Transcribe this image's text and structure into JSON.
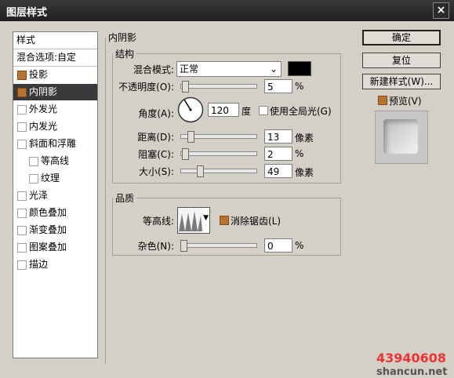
{
  "window": {
    "title": "图层样式",
    "close": "×"
  },
  "styles_list": {
    "header": "样式",
    "blend_options": "混合选项:自定",
    "items": [
      {
        "label": "投影",
        "checked": true,
        "selected": false,
        "sub": false
      },
      {
        "label": "内阴影",
        "checked": true,
        "selected": true,
        "sub": false
      },
      {
        "label": "外发光",
        "checked": false,
        "selected": false,
        "sub": false
      },
      {
        "label": "内发光",
        "checked": false,
        "selected": false,
        "sub": false
      },
      {
        "label": "斜面和浮雕",
        "checked": false,
        "selected": false,
        "sub": false
      },
      {
        "label": "等高线",
        "checked": false,
        "selected": false,
        "sub": true
      },
      {
        "label": "纹理",
        "checked": false,
        "selected": false,
        "sub": true
      },
      {
        "label": "光泽",
        "checked": false,
        "selected": false,
        "sub": false
      },
      {
        "label": "颜色叠加",
        "checked": false,
        "selected": false,
        "sub": false
      },
      {
        "label": "渐变叠加",
        "checked": false,
        "selected": false,
        "sub": false
      },
      {
        "label": "图案叠加",
        "checked": false,
        "selected": false,
        "sub": false
      },
      {
        "label": "描边",
        "checked": false,
        "selected": false,
        "sub": false
      }
    ]
  },
  "inner_shadow": {
    "title": "内阴影",
    "structure": {
      "title": "结构",
      "blend_mode_label": "混合模式:",
      "blend_mode_value": "正常",
      "color": "#000000",
      "opacity_label": "不透明度(O):",
      "opacity_value": "5",
      "opacity_unit": "%",
      "angle_label": "角度(A):",
      "angle_value": "120",
      "angle_unit": "度",
      "global_light_label": "使用全局光(G)",
      "global_light_checked": false,
      "distance_label": "距离(D):",
      "distance_value": "13",
      "distance_unit": "像素",
      "choke_label": "阻塞(C):",
      "choke_value": "2",
      "choke_unit": "%",
      "size_label": "大小(S):",
      "size_value": "49",
      "size_unit": "像素"
    },
    "quality": {
      "title": "品质",
      "contour_label": "等高线:",
      "anti_alias_label": "消除锯齿(L)",
      "anti_alias_checked": true,
      "noise_label": "杂色(N):",
      "noise_value": "0",
      "noise_unit": "%"
    }
  },
  "buttons": {
    "ok": "确定",
    "reset": "复位",
    "new_style": "新建样式(W)...",
    "preview": "预览(V)",
    "preview_checked": true
  },
  "watermark": {
    "number": "43940608",
    "site": "shancun.net"
  }
}
